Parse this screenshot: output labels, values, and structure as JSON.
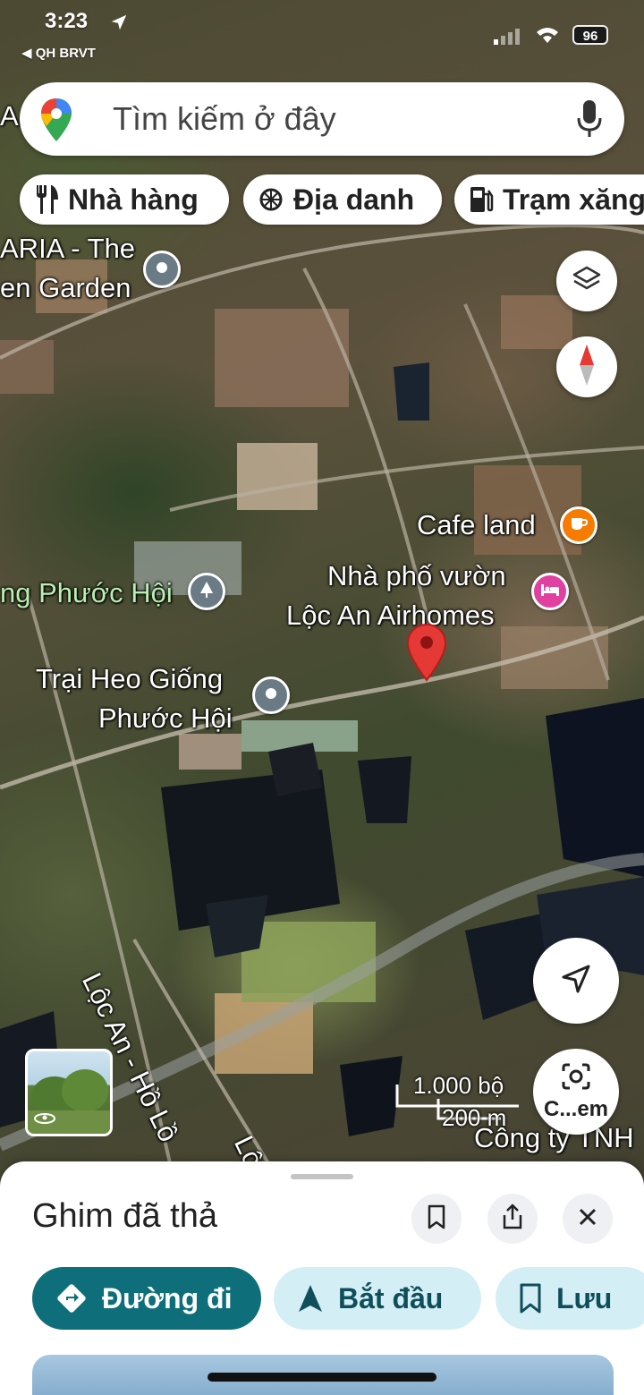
{
  "status_bar": {
    "time": "3:23",
    "carrier_back": "◀ QH BRVT",
    "battery": "96"
  },
  "search": {
    "placeholder": "Tìm kiếm ở đây"
  },
  "chips": [
    {
      "label": "Nhà hàng",
      "icon": "fork-knife-icon"
    },
    {
      "label": "Địa danh",
      "icon": "landmark-icon"
    },
    {
      "label": "Trạm xăng",
      "icon": "gas-station-icon"
    }
  ],
  "map_labels": {
    "aria_line1": "ARIA - The",
    "aria_line2": "en Garden",
    "cafe": "Cafe land",
    "airhomes_line1": "Nhà phố vườn",
    "airhomes_line2": "Lộc An Airhomes",
    "park": "ng Phước Hội",
    "farm_line1": "Trại Heo Giống",
    "farm_line2": "Phước Hội",
    "road": "Lộc An - Hồ Lồ",
    "road_cut": "Lộ",
    "company": "Công ty TNH",
    "top_left_cut": "A"
  },
  "scale": {
    "feet": "1.000 bộ",
    "meters": "200 m"
  },
  "camera_button_label": "C...em",
  "sheet": {
    "title": "Ghim đã thả",
    "actions": {
      "directions": "Đường đi",
      "start": "Bắt đầu",
      "save": "Lưu"
    }
  },
  "colors": {
    "primary": "#0e6f7a",
    "secondary_bg": "#d4eef6",
    "pin": "#e53935",
    "cafe_poi": "#f57c00",
    "hotel_poi": "#e040a0"
  }
}
